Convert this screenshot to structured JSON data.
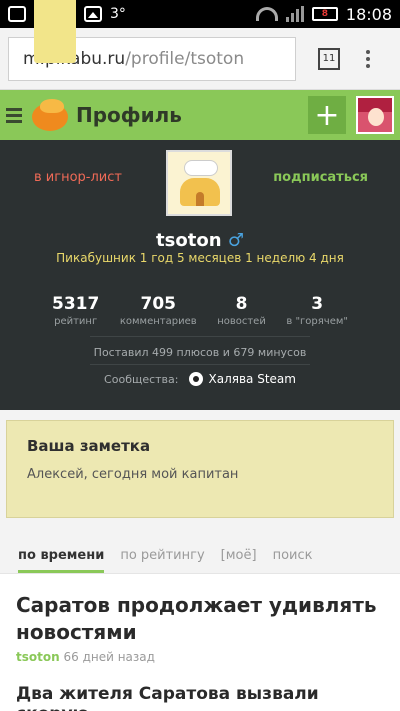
{
  "statusbar": {
    "temperature": "3°",
    "battery": "8",
    "time": "18:08"
  },
  "browser": {
    "url_host": "m.pikabu.ru",
    "url_path": "/profile/tsoton",
    "tab_count": "11"
  },
  "header": {
    "title": "Профиль",
    "add_label": "+"
  },
  "profile": {
    "ignore_label": "в игнор-лист",
    "subscribe_label": "подписаться",
    "username": "tsoton",
    "gender_symbol": "♂",
    "since": "Пикабушник 1 год 5 месяцев 1 неделю 4 дня",
    "stats": [
      {
        "value": "5317",
        "label": "рейтинг"
      },
      {
        "value": "705",
        "label": "комментариев"
      },
      {
        "value": "8",
        "label": "новостей"
      },
      {
        "value": "3",
        "label": "в \"горячем\""
      }
    ],
    "votes": "Поставил 499 плюсов и 679 минусов",
    "communities_label": "Сообщества:",
    "community": "Халява Steam"
  },
  "note": {
    "title": "Ваша заметка",
    "text": "Алексей, сегодня мой капитан"
  },
  "tabs": [
    "по времени",
    "по рейтингу",
    "[моё]",
    "поиск"
  ],
  "post": {
    "title": "Саратов продолжает удивлять новостями",
    "author": "tsoton",
    "time": "66 дней назад",
    "text": "Два жителя Саратова вызвали скорую,"
  },
  "colors": {
    "accent": "#8ac858",
    "dark_panel": "#2c3132",
    "ignore": "#f06a57",
    "note_bg": "#ede8b2"
  }
}
